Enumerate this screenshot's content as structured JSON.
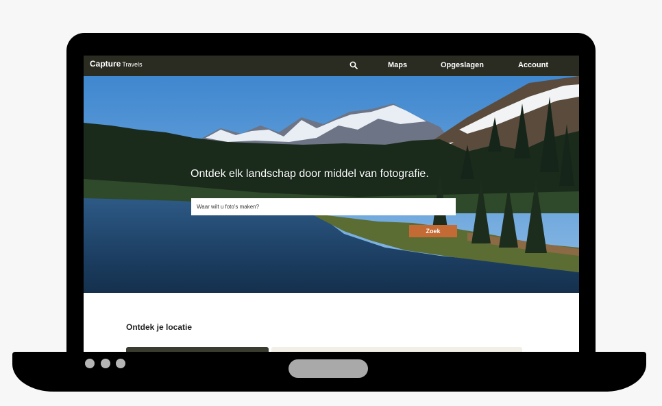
{
  "nav": {
    "brand_main": "Capture",
    "brand_sub": "Travels",
    "search_icon": "search-icon",
    "links": [
      "Maps",
      "Opgeslagen",
      "Account"
    ]
  },
  "hero": {
    "headline": "Ontdek elk landschap door middel van fotografie.",
    "search_placeholder": "Waar wilt u foto's maken?",
    "search_button": "Zoek"
  },
  "section": {
    "title": "Ontdek je locatie"
  },
  "colors": {
    "nav_bg": "#2a2c21",
    "accent": "#c46a35"
  }
}
